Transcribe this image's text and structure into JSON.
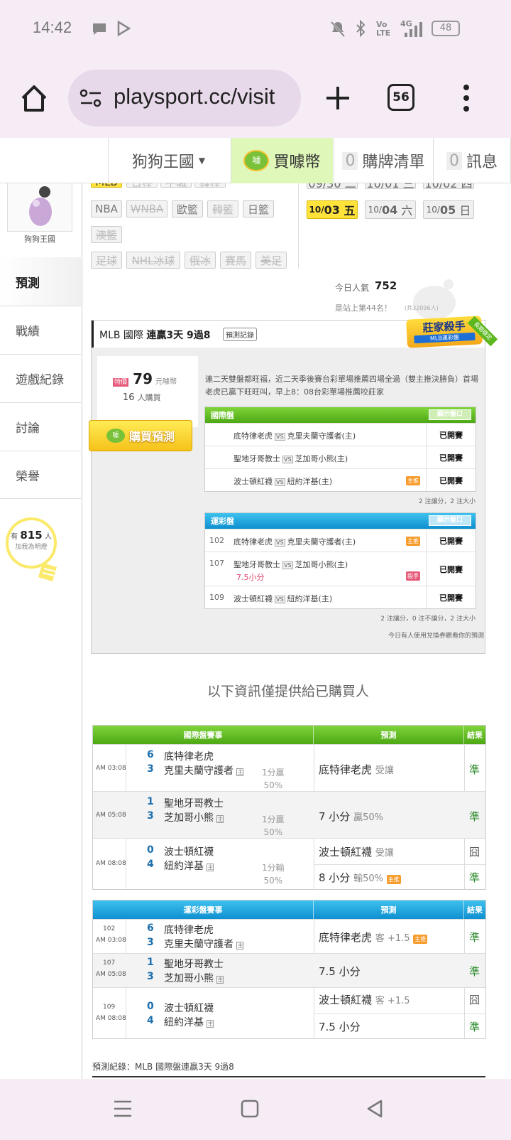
{
  "status_bar": {
    "time": "14:42",
    "battery": "48",
    "network": "4G"
  },
  "browser": {
    "url": "playsport.cc/visit",
    "tab_count": "56"
  },
  "top_nav": {
    "user": "狗狗王國",
    "buy_coins": "買噱幣",
    "cart_count": "0",
    "cart_label": "購牌清單",
    "msg_count": "0",
    "msg_label": "訊息"
  },
  "profile": {
    "name": "狗狗王國"
  },
  "sports": {
    "row1": [
      "MLB",
      "日棒",
      "中職",
      "韓棒"
    ],
    "row2": [
      "NBA",
      "WNBA",
      "歐籃",
      "韓籃",
      "日籃"
    ],
    "row3": [
      "澳籃"
    ],
    "row4": [
      "足球",
      "NHL冰球",
      "俄冰",
      "賽馬",
      "美足"
    ]
  },
  "dates": {
    "row1": [
      "09/30 二",
      "10/01 三",
      "10/02 四"
    ],
    "row2": [
      {
        "m": "10/",
        "d": "03",
        "w": "五"
      },
      {
        "m": "10/",
        "d": "04",
        "w": "六"
      },
      {
        "m": "10/",
        "d": "05",
        "w": "日"
      }
    ]
  },
  "sidebar": {
    "items": [
      "預測",
      "戰績",
      "遊戲紀錄",
      "討論",
      "榮譽"
    ],
    "fans_prefix": "有",
    "fans_count": "815",
    "fans_suffix": "人",
    "fans_cta": "加我為明燈"
  },
  "popularity": {
    "label": "今日人氣",
    "value": "752",
    "rank": "是站上第44名！",
    "rank_extra": "(共32096人)"
  },
  "prediction": {
    "title_prefix": "MLB 國際",
    "title_bold": "連贏3天 9過8",
    "record_btn": "預測記錄",
    "badge_title": "莊家殺手",
    "badge_sub": "MLB運彩盤",
    "badge_ribbon": "長期穩定",
    "price_tag": "特價",
    "price": "79",
    "price_unit": "元噱幣",
    "buyers": "16",
    "buyers_unit": "人購買",
    "buy_btn": "購買預測",
    "desc": "連二天雙盤都旺福，近二天季後賽台彩單場推薦四場全過（雙主推決勝負）首場老虎已贏下旺旺叫，早上8：08台彩單場推薦咬莊家",
    "intl": {
      "title": "國際盤",
      "btn": "顯示盤口",
      "rows": [
        {
          "away": "底特律老虎",
          "home": "克里夫蘭守護者(主)",
          "tag": "",
          "status": "已開賽"
        },
        {
          "away": "聖地牙哥教士",
          "home": "芝加哥小熊(主)",
          "tag": "",
          "status": "已開賽"
        },
        {
          "away": "波士頓紅襪",
          "home": "紐約洋基(主)",
          "tag": "主推",
          "status": "已開賽"
        }
      ],
      "summary": "2 注讓分，2 注大小"
    },
    "sport": {
      "title": "運彩盤",
      "btn": "顯示盤口",
      "rows": [
        {
          "num": "102",
          "away": "底特律老虎",
          "home": "克里夫蘭守護者(主)",
          "extra": "",
          "tag": "主推",
          "status": "已開賽"
        },
        {
          "num": "107",
          "away": "聖地牙哥教士",
          "home": "芝加哥小熊(主)",
          "extra": "7.5小分",
          "tag": "殺手",
          "status": "已開賽"
        },
        {
          "num": "109",
          "away": "波士頓紅襪",
          "home": "紐約洋基(主)",
          "extra": "",
          "tag": "",
          "status": "已開賽"
        }
      ],
      "summary": "2 注讓分，0 注不讓分，2 注大小",
      "note": "今日有人使用兌換券觀看你的預測"
    }
  },
  "buyers_only": "以下資訊僅提供給已購買人",
  "result_intl": {
    "headers": [
      "國際盤賽事",
      "預測",
      "結果"
    ],
    "rows": [
      {
        "time": "AM 03:08",
        "s1": "6",
        "s2": "3",
        "t1": "底特律老虎",
        "t2": "克里夫蘭守護者",
        "line1": "1分贏",
        "line2": "50%",
        "preds": [
          {
            "main": "底特律老虎",
            "sub": "受讓",
            "res": "準"
          }
        ]
      },
      {
        "time": "AM 05:08",
        "s1": "1",
        "s2": "3",
        "t1": "聖地牙哥教士",
        "t2": "芝加哥小熊",
        "line1": "1分贏",
        "line2": "50%",
        "preds": [
          {
            "main": "7 小分",
            "sub": "贏50%",
            "res": "準"
          }
        ]
      },
      {
        "time": "AM 08:08",
        "s1": "0",
        "s2": "4",
        "t1": "波士頓紅襪",
        "t2": "紐約洋基",
        "line1": "1分輸",
        "line2": "50%",
        "preds": [
          {
            "main": "波士頓紅襪",
            "sub": "受讓",
            "res": "囧"
          },
          {
            "main": "8 小分",
            "sub": "輸50%",
            "res": "準"
          }
        ]
      }
    ]
  },
  "result_sport": {
    "headers": [
      "運彩盤賽事",
      "預測",
      "結果"
    ],
    "rows": [
      {
        "num": "102",
        "time": "AM 03:08",
        "s1": "6",
        "s2": "3",
        "t1": "底特律老虎",
        "t2": "克里夫蘭守護者",
        "preds": [
          {
            "main": "底特律老虎",
            "sub": "客 +1.5",
            "res": "準"
          }
        ]
      },
      {
        "num": "107",
        "time": "AM 05:08",
        "s1": "1",
        "s2": "3",
        "t1": "聖地牙哥教士",
        "t2": "芝加哥小熊",
        "preds": [
          {
            "main": "7.5 小分",
            "sub": "",
            "res": "準"
          }
        ]
      },
      {
        "num": "109",
        "time": "AM 08:08",
        "s1": "0",
        "s2": "4",
        "t1": "波士頓紅襪",
        "t2": "紐約洋基",
        "preds": [
          {
            "main": "波士頓紅襪",
            "sub": "客 +1.5",
            "res": "囧"
          },
          {
            "main": "7.5 小分",
            "sub": "",
            "res": "準"
          }
        ]
      }
    ]
  },
  "footer_record": "預測紀錄：MLB 國際盤連贏3天 9過8",
  "home_tag": "主",
  "colors": {
    "green": "#5cb81e",
    "blue": "#1aa3e2",
    "yellow": "#ffe33a"
  }
}
